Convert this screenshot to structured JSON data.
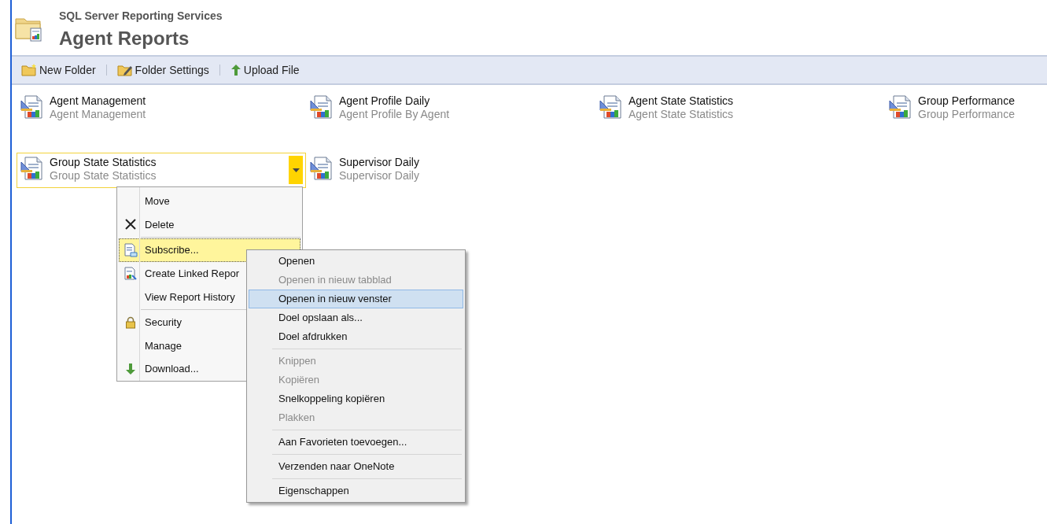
{
  "header": {
    "product": "SQL Server Reporting Services",
    "title": "Agent Reports"
  },
  "toolbar": [
    {
      "label": "New Folder",
      "kind": "new-folder"
    },
    {
      "label": "Folder Settings",
      "kind": "folder-settings"
    },
    {
      "label": "Upload File",
      "kind": "upload"
    }
  ],
  "reports": [
    {
      "name": "Agent Management",
      "description": "Agent Management",
      "selected": false
    },
    {
      "name": "Agent Profile Daily",
      "description": "Agent Profile By Agent",
      "selected": false
    },
    {
      "name": "Agent State Statistics",
      "description": "Agent State Statistics",
      "selected": false
    },
    {
      "name": "Group Performance",
      "description": "Group Performance",
      "selected": false
    },
    {
      "name": "Group State Statistics",
      "description": "Group State Statistics",
      "selected": true
    },
    {
      "name": "Supervisor Daily",
      "description": "Supervisor Daily",
      "selected": false
    }
  ],
  "item_menu": {
    "groups": [
      [
        {
          "label": "Move",
          "kind": "plain",
          "selected": false
        },
        {
          "label": "Delete",
          "kind": "delete",
          "selected": false
        }
      ],
      [
        {
          "label": "Subscribe...",
          "kind": "subscribe",
          "selected": true
        },
        {
          "label": "Create Linked Repor",
          "kind": "linked",
          "selected": false
        },
        {
          "label": "View Report History",
          "kind": "plain",
          "selected": false
        }
      ],
      [
        {
          "label": "Security",
          "kind": "lock",
          "selected": false
        },
        {
          "label": "Manage",
          "kind": "plain",
          "selected": false
        },
        {
          "label": "Download...",
          "kind": "download",
          "selected": false
        }
      ]
    ]
  },
  "context_menu": {
    "groups": [
      [
        {
          "label": "Openen",
          "disabled": false,
          "selected": false
        },
        {
          "label": "Openen in nieuw tabblad",
          "disabled": true,
          "selected": false
        },
        {
          "label": "Openen in nieuw venster",
          "disabled": false,
          "selected": true
        },
        {
          "label": "Doel opslaan als...",
          "disabled": false,
          "selected": false
        },
        {
          "label": "Doel afdrukken",
          "disabled": false,
          "selected": false
        }
      ],
      [
        {
          "label": "Knippen",
          "disabled": true,
          "selected": false
        },
        {
          "label": "Kopiëren",
          "disabled": true,
          "selected": false
        },
        {
          "label": "Snelkoppeling kopiëren",
          "disabled": false,
          "selected": false
        },
        {
          "label": "Plakken",
          "disabled": true,
          "selected": false
        }
      ],
      [
        {
          "label": "Aan Favorieten toevoegen...",
          "disabled": false,
          "selected": false
        }
      ],
      [
        {
          "label": "Verzenden naar OneNote",
          "disabled": false,
          "selected": false
        }
      ],
      [
        {
          "label": "Eigenschappen",
          "disabled": false,
          "selected": false
        }
      ]
    ]
  }
}
